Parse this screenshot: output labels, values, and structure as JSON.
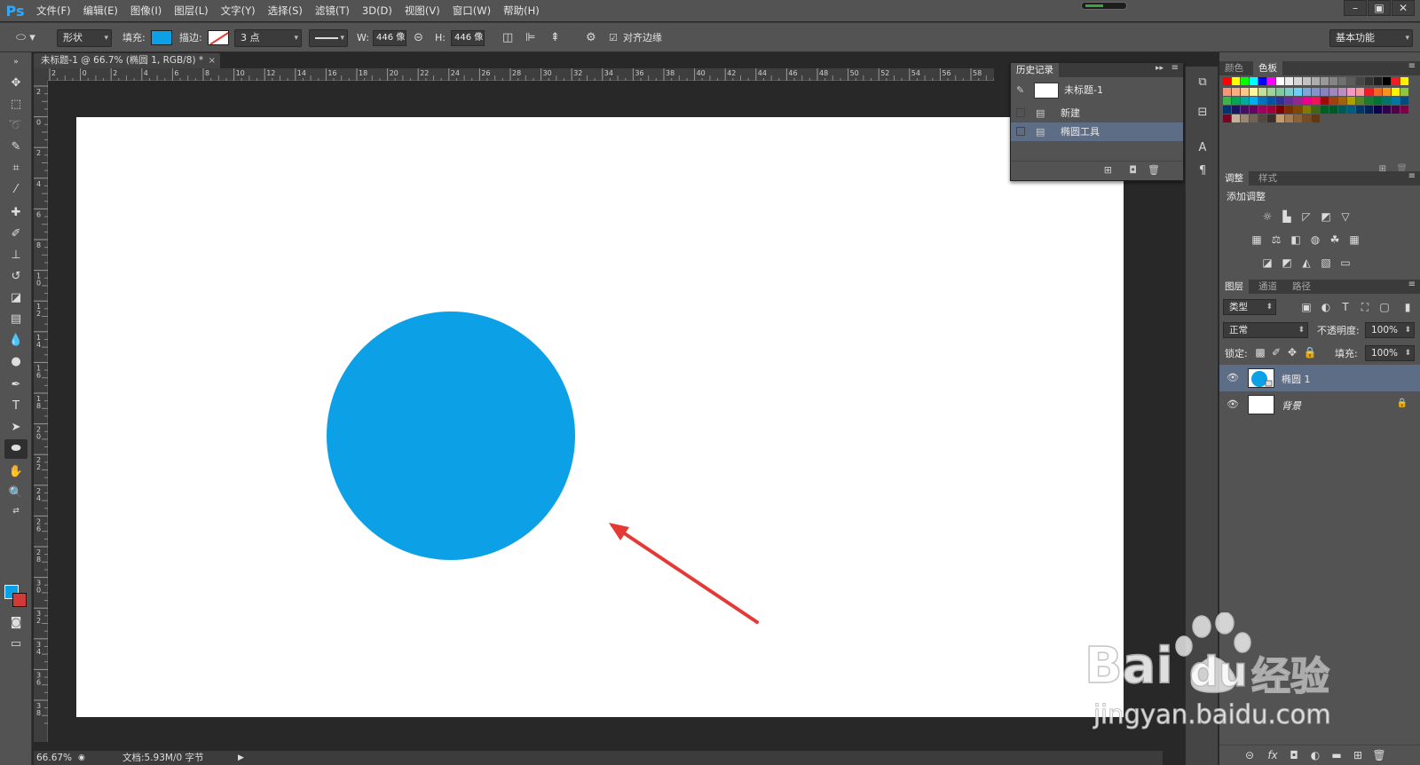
{
  "app": {
    "logo": "Ps",
    "menu": [
      "文件(F)",
      "编辑(E)",
      "图像(I)",
      "图层(L)",
      "文字(Y)",
      "选择(S)",
      "滤镜(T)",
      "3D(D)",
      "视图(V)",
      "窗口(W)",
      "帮助(H)"
    ],
    "window_controls": [
      "–",
      "▣",
      "✕"
    ]
  },
  "options_bar": {
    "mode": "形状",
    "fill_label": "填充:",
    "stroke_label": "描边:",
    "stroke_width": "3 点",
    "w_label": "W:",
    "w_value": "446 像",
    "h_label": "H:",
    "h_value": "446 像",
    "align_edges_label": "对齐边缘",
    "workspace": "基本功能",
    "fill_color": "#0ca0e6"
  },
  "document": {
    "tab_title": "未标题-1 @ 66.7% (椭圆 1, RGB/8) *",
    "tab_close": "×",
    "ruler_h": [
      "2",
      "0",
      "2",
      "4",
      "6",
      "8",
      "10",
      "12",
      "14",
      "16",
      "18",
      "20",
      "22",
      "24",
      "26",
      "28",
      "30",
      "32",
      "34",
      "36",
      "38",
      "40",
      "42",
      "44",
      "46",
      "48",
      "50",
      "52",
      "54",
      "56",
      "58"
    ],
    "ruler_v": [
      "2",
      "0",
      "2",
      "4",
      "6",
      "8",
      "10",
      "12",
      "14",
      "16",
      "18",
      "20",
      "22",
      "24",
      "26",
      "28",
      "30",
      "32",
      "34",
      "36",
      "38"
    ],
    "zoom": "66.67%",
    "doc_info": "文档:5.93M/0 字节",
    "shape_color": "#0ca0e6",
    "arrow_color": "#e53935"
  },
  "history_panel": {
    "tab": "历史记录",
    "snapshot": "未标题-1",
    "items": [
      "新建",
      "椭圆工具"
    ]
  },
  "color_panel": {
    "tabs": [
      "颜色",
      "色板"
    ]
  },
  "adjust_panel": {
    "tabs": [
      "调整",
      "样式"
    ],
    "title": "添加调整"
  },
  "layers_panel": {
    "tabs": [
      "图层",
      "通道",
      "路径"
    ],
    "filter": "类型",
    "blend_mode": "正常",
    "opacity_label": "不透明度:",
    "opacity": "100%",
    "lock_label": "锁定:",
    "fill_label": "填充:",
    "fill": "100%",
    "layers": [
      {
        "name": "椭圆 1",
        "selected": true
      },
      {
        "name": "背景",
        "selected": false
      }
    ]
  },
  "watermark": {
    "brand": "Bai",
    "brand2": "du",
    "cn": "经验",
    "url": "jingyan.baidu.com"
  }
}
